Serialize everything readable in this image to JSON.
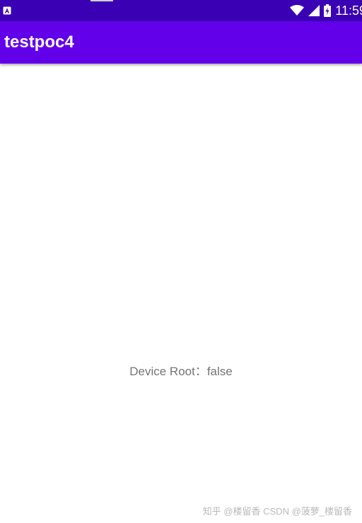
{
  "status_bar": {
    "time": "11:59",
    "background": "#3a00b4",
    "icons": [
      "app-notification-icon",
      "wifi-icon",
      "cellular-signal-icon",
      "battery-charging-icon"
    ]
  },
  "app_bar": {
    "title": "testpoc4",
    "background": "#6200ea"
  },
  "main": {
    "root_status_text": "Device Root：false",
    "text_color": "#757575"
  },
  "watermark": {
    "text": "知乎 @楼留香 CSDN @菠萝_楼留香"
  }
}
